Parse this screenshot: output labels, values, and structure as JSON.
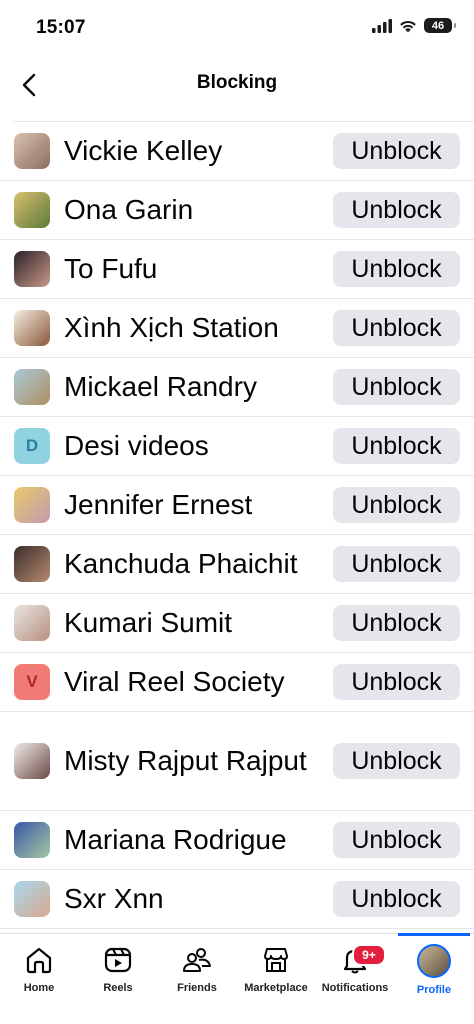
{
  "status_bar": {
    "time": "15:07",
    "battery": "46"
  },
  "header": {
    "title": "Blocking"
  },
  "blocked_users": [
    {
      "name": "Vickie Kelley",
      "avatar_colors": [
        "#d9c2b0",
        "#8c6e60"
      ]
    },
    {
      "name": "Ona Garin",
      "avatar_colors": [
        "#d8c070",
        "#5d7a3a"
      ]
    },
    {
      "name": "To Fufu",
      "avatar_colors": [
        "#2b2228",
        "#c99a8a"
      ]
    },
    {
      "name": "Xình Xịch Station",
      "avatar_colors": [
        "#f4ece0",
        "#8b5a3a"
      ]
    },
    {
      "name": "Mickael Randry",
      "avatar_colors": [
        "#a8c8d8",
        "#b09060"
      ]
    },
    {
      "name": "Desi videos",
      "avatar_letter": "D",
      "avatar_colors": [
        "#8fd3e0",
        "#2c7fa0"
      ]
    },
    {
      "name": "Jennifer Ernest",
      "avatar_colors": [
        "#e6c96a",
        "#c59ab0"
      ]
    },
    {
      "name": "Kanchuda Phaichit",
      "avatar_colors": [
        "#3a2e2a",
        "#b88a70"
      ]
    },
    {
      "name": "Kumari Sumit",
      "avatar_colors": [
        "#e9e6e2",
        "#b89080"
      ]
    },
    {
      "name": "Viral Reel Society",
      "avatar_letter": "V",
      "avatar_colors": [
        "#f07a74",
        "#b02828"
      ]
    },
    {
      "name": "Misty Rajput Rajput",
      "avatar_colors": [
        "#f2ecea",
        "#6a4a44"
      ]
    },
    {
      "name": "Mariana Rodrigue",
      "avatar_colors": [
        "#3a58a8",
        "#a4c8a0"
      ]
    },
    {
      "name": "Sxr Xnn",
      "avatar_colors": [
        "#a8d8ec",
        "#d8a890"
      ]
    },
    {
      "name": "",
      "avatar_colors": [
        "#e8d070",
        "#c0a040"
      ]
    }
  ],
  "unblock_label": "Unblock",
  "tab_bar": {
    "tabs": [
      {
        "label": "Home",
        "icon": "home-icon"
      },
      {
        "label": "Reels",
        "icon": "reels-icon"
      },
      {
        "label": "Friends",
        "icon": "friends-icon"
      },
      {
        "label": "Marketplace",
        "icon": "marketplace-icon"
      },
      {
        "label": "Notifications",
        "icon": "bell-icon",
        "badge": "9+"
      },
      {
        "label": "Profile",
        "icon": "profile-avatar",
        "active": true
      }
    ]
  },
  "colors": {
    "accent": "#0866ff",
    "button_bg": "#e4e6eb",
    "badge": "#e41e3f"
  }
}
